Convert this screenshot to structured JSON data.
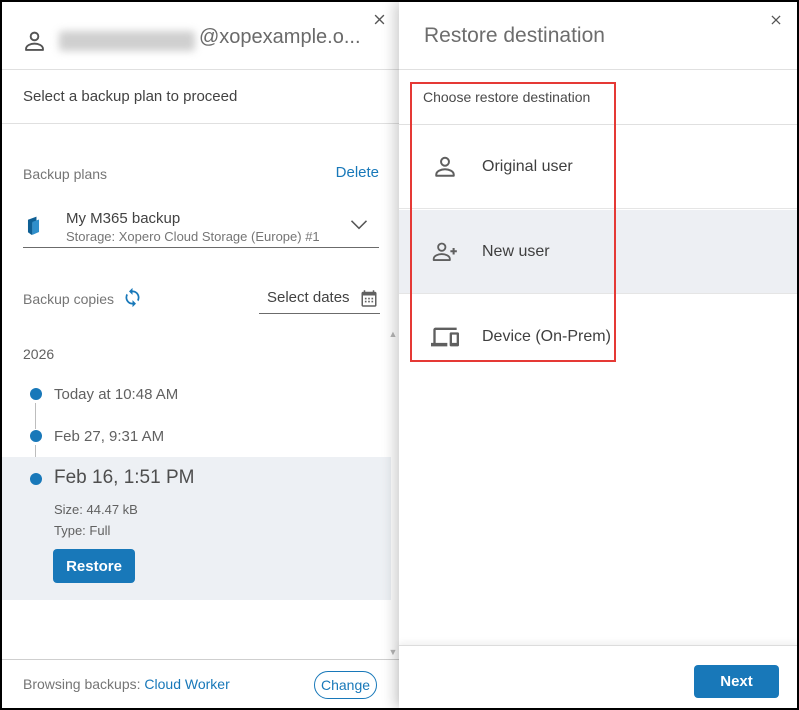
{
  "colors": {
    "accent_blue": "#1878b9",
    "annotation_red": "#e53935",
    "selected_row_bg": "#edf0f4"
  },
  "left_panel": {
    "header": {
      "email_suffix": "@xopexample.o...",
      "person_icon": "person-icon",
      "close_icon": "close-icon"
    },
    "subtitle": "Select a backup plan to proceed",
    "backup_plans": {
      "label": "Backup plans",
      "delete_label": "Delete",
      "selected_plan": {
        "name": "My M365 backup",
        "storage": "Storage: Xopero Cloud Storage (Europe) #1",
        "plan_icon": "m365-icon",
        "chevron_icon": "chevron-down-icon"
      }
    },
    "backup_copies": {
      "label": "Backup copies",
      "refresh_icon": "sync-icon",
      "select_dates_label": "Select dates",
      "calendar_icon": "calendar-icon",
      "year": "2026",
      "entries": [
        {
          "label": "Today at 10:48 AM",
          "selected": false
        },
        {
          "label": "Feb 27, 9:31 AM",
          "selected": false
        },
        {
          "label": "Feb 16, 1:51 PM",
          "selected": true,
          "size": "Size: 44.47 kB",
          "type": "Type: Full",
          "restore_label": "Restore"
        }
      ]
    },
    "footer": {
      "browsing_label": "Browsing backups:",
      "browsing_value": "Cloud Worker",
      "change_label": "Change"
    }
  },
  "right_panel": {
    "title": "Restore destination",
    "close_icon": "close-icon",
    "choose_label": "Choose restore destination",
    "options": [
      {
        "label": "Original user",
        "icon": "person-icon"
      },
      {
        "label": "New user",
        "icon": "person-add-icon"
      },
      {
        "label": "Device (On-Prem)",
        "icon": "devices-icon"
      }
    ],
    "next_label": "Next"
  }
}
